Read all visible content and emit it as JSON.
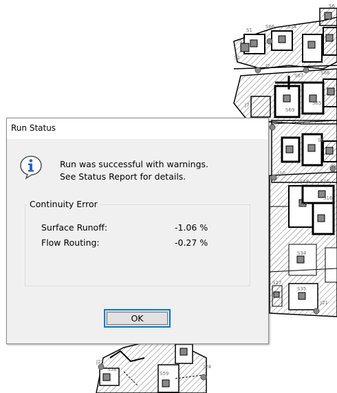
{
  "background_map": {
    "labels": [
      "S1",
      "S66",
      "S54",
      "S6",
      "S3",
      "J2",
      "S2",
      "S67",
      "S68",
      "S69",
      "S65",
      "S70",
      "J7",
      "S6",
      "J10",
      "S18",
      "S17",
      "S16",
      "S15",
      "J9",
      "S34",
      "S27",
      "S35",
      "J21",
      "J23",
      "S58",
      "S59",
      "J24"
    ]
  },
  "dialog": {
    "title": "Run Status",
    "icon": "info-icon",
    "message_line1": "Run was successful with warnings.",
    "message_line2": "See Status Report for details.",
    "group_title": "Continuity Error",
    "rows": [
      {
        "label": "Surface Runoff:",
        "value": "-1.06 %"
      },
      {
        "label": "Flow Routing:",
        "value": "-0.27 %"
      }
    ],
    "ok_label": "OK"
  },
  "colors": {
    "dialog_face": "#f0f0f0",
    "button_face": "#e1e1e1",
    "focus_border": "#0078d7",
    "icon_blue": "#2a62c8"
  }
}
